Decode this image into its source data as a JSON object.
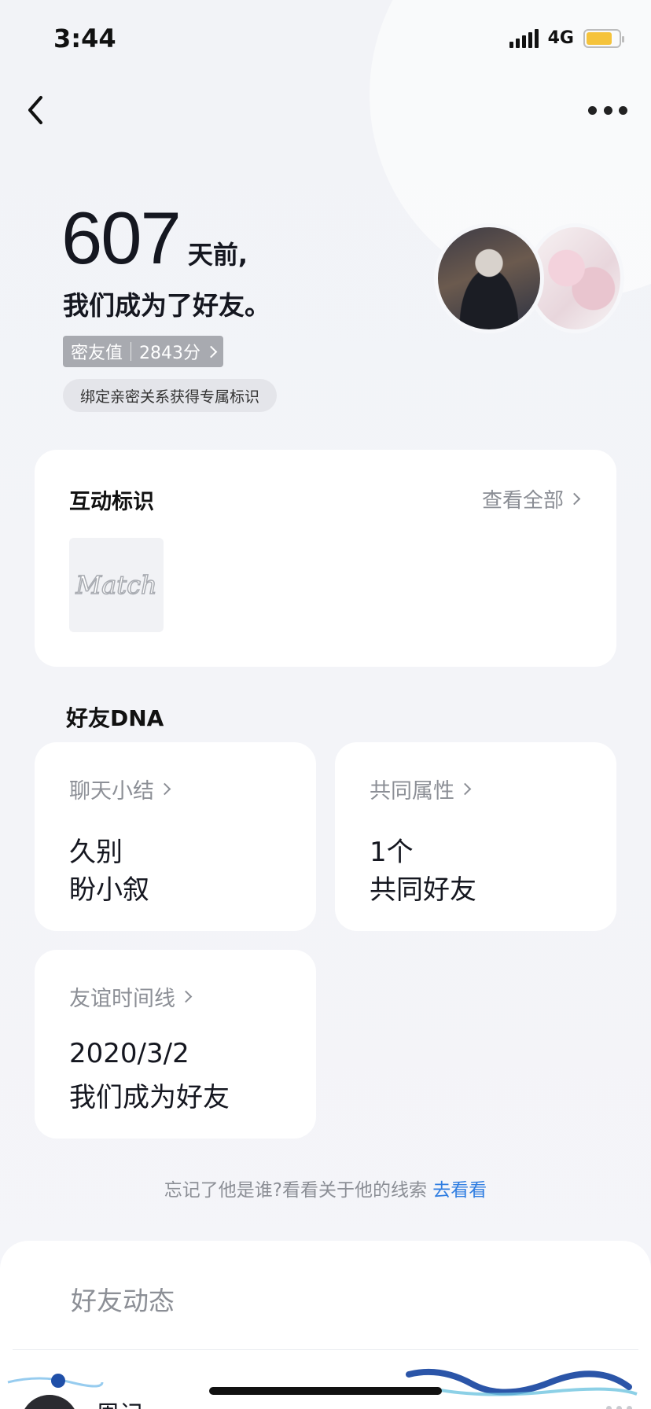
{
  "status_bar": {
    "time": "3:44",
    "network": "4G"
  },
  "header": {
    "days": "607",
    "days_suffix": "天前,",
    "friend_text": "我们成为了好友。",
    "intimacy_label": "密友值",
    "intimacy_value": "2843分",
    "bind_hint": "绑定亲密关系获得专属标识"
  },
  "interaction": {
    "title": "互动标识",
    "view_all": "查看全部",
    "badge_text": "Match"
  },
  "dna": {
    "title": "好友DNA",
    "chat_summary": {
      "label": "聊天小结",
      "line1": "久别",
      "line2": "盼小叙"
    },
    "common": {
      "label": "共同属性",
      "line1": "1个",
      "line2": "共同好友"
    },
    "timeline": {
      "label": "友谊时间线",
      "line1": "2020/3/2",
      "line2": "我们成为好友"
    }
  },
  "hint": {
    "text": "忘记了他是谁?看看关于他的线索 ",
    "link": "去看看"
  },
  "feed": {
    "title": "好友动态",
    "first_name": "周记"
  },
  "colors": {
    "accent_link": "#2f7de1",
    "battery": "#f5c33b"
  }
}
